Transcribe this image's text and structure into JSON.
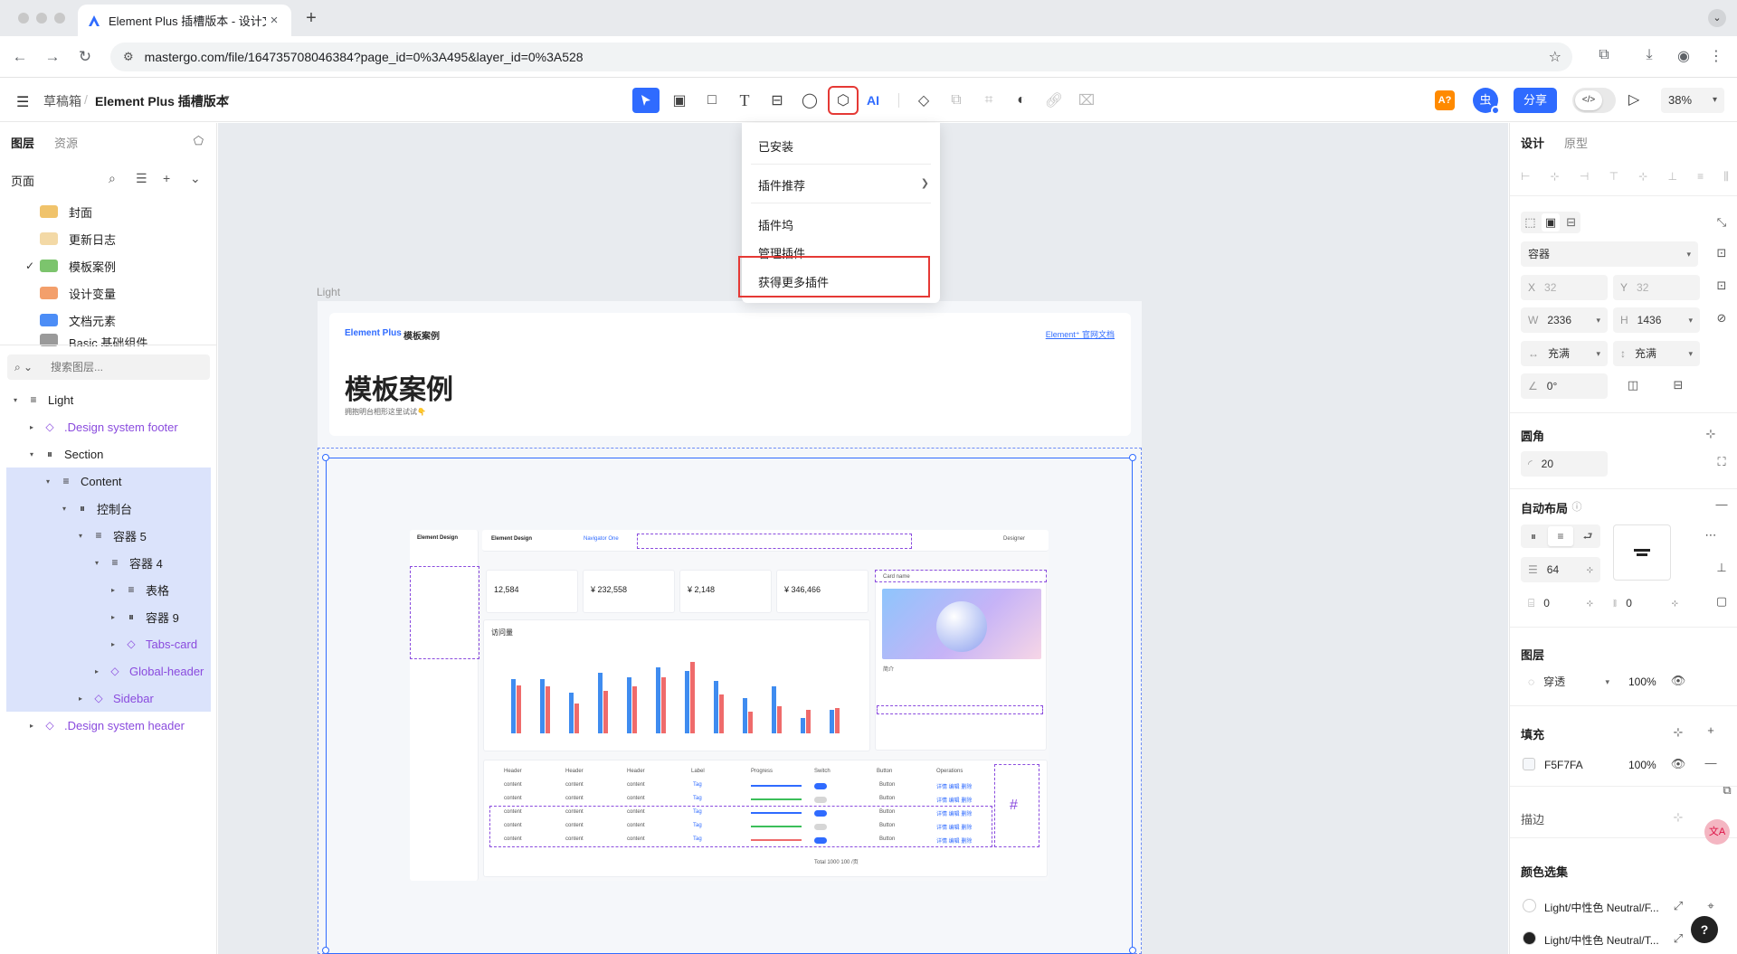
{
  "browser": {
    "tab_title": "Element Plus 插槽版本 - 设计文档",
    "url": "mastergo.com/file/164735708046384?page_id=0%3A495&layer_id=0%3A528"
  },
  "app": {
    "breadcrumb_root": "草稿箱",
    "breadcrumb_sep": "/",
    "file_name": "Element Plus 插槽版本",
    "ai_label": "AI",
    "badge_label": "A?",
    "avatar_label": "虫",
    "share_label": "分享",
    "zoom": "38%"
  },
  "left": {
    "tabs": [
      "图层",
      "资源"
    ],
    "pages_label": "页面",
    "pages": [
      {
        "name": "封面",
        "color": "#f0c36b",
        "current": false
      },
      {
        "name": "更新日志",
        "color": "#f3d9a6",
        "current": false
      },
      {
        "name": "模板案例",
        "color": "#7cc46d",
        "current": true
      },
      {
        "name": "设计变量",
        "color": "#f39f6b",
        "current": false
      },
      {
        "name": "文档元素",
        "color": "#4c8df6",
        "current": false
      },
      {
        "name": "Basic 基础组件",
        "color": "#9a9a9a",
        "current": false
      }
    ],
    "search_placeholder": "搜索图层...",
    "layers": [
      {
        "name": "Light",
        "icon": "≡",
        "indent": 0,
        "arrow": "▾",
        "selected": false,
        "component": false
      },
      {
        "name": ".Design system footer",
        "icon": "◇",
        "indent": 1,
        "arrow": "▸",
        "selected": false,
        "component": true
      },
      {
        "name": "Section",
        "icon": "⏸",
        "indent": 1,
        "arrow": "▾",
        "selected": false,
        "component": false
      },
      {
        "name": "Content",
        "icon": "≡",
        "indent": 2,
        "arrow": "▾",
        "selected": true,
        "component": false
      },
      {
        "name": "控制台",
        "icon": "⏸",
        "indent": 3,
        "arrow": "▾",
        "selected": true,
        "component": false
      },
      {
        "name": "容器 5",
        "icon": "≡",
        "indent": 4,
        "arrow": "▾",
        "selected": true,
        "component": false
      },
      {
        "name": "容器 4",
        "icon": "≡",
        "indent": 5,
        "arrow": "▾",
        "selected": true,
        "component": false
      },
      {
        "name": "表格",
        "icon": "≡",
        "indent": 6,
        "arrow": "▸",
        "selected": true,
        "component": false
      },
      {
        "name": "容器 9",
        "icon": "⏸",
        "indent": 6,
        "arrow": "▸",
        "selected": true,
        "component": false
      },
      {
        "name": "Tabs-card",
        "icon": "◇",
        "indent": 6,
        "arrow": "▸",
        "selected": true,
        "component": true
      },
      {
        "name": "Global-header",
        "icon": "◇",
        "indent": 5,
        "arrow": "▸",
        "selected": true,
        "component": true
      },
      {
        "name": "Sidebar",
        "icon": "◇",
        "indent": 4,
        "arrow": "▸",
        "selected": true,
        "component": true
      },
      {
        "name": ".Design system header",
        "icon": "◇",
        "indent": 1,
        "arrow": "▸",
        "selected": false,
        "component": true
      }
    ]
  },
  "dropdown": {
    "items": [
      "已安装",
      "插件推荐",
      "插件坞",
      "管理插件",
      "获得更多插件"
    ]
  },
  "canvas": {
    "frame_label": "Light",
    "brand": "Element Plus",
    "brand_page": "模板案例",
    "doc_link": "Element⁺ 官网文档",
    "title": "模板案例",
    "subtitle": "拥抱明台相形这里试试👇",
    "mock": {
      "logo": "Element Design",
      "logo2": "Element Design",
      "nav_item": "Navigator One",
      "user": "Designer",
      "stats": [
        "12,584",
        "¥ 232,558",
        "¥ 2,148",
        "¥ 346,466"
      ],
      "chart_title": "访问量",
      "card_name": "Card name",
      "card_sub": "简介",
      "table_headers": [
        "Header",
        "Header",
        "Header",
        "Label",
        "Progress",
        "Switch",
        "Button",
        "Operations"
      ],
      "cell": "content",
      "tag": "Tag",
      "button": "Button",
      "ops": "详情 编辑 删除",
      "pagination": "Total 1000   100 /页"
    },
    "bars": [
      [
        0.7,
        0.62
      ],
      [
        0.7,
        0.6
      ],
      [
        0.52,
        0.38
      ],
      [
        0.78,
        0.55
      ],
      [
        0.72,
        0.6
      ],
      [
        0.85,
        0.72
      ],
      [
        0.8,
        0.92
      ],
      [
        0.68,
        0.5
      ],
      [
        0.45,
        0.28
      ],
      [
        0.6,
        0.35
      ],
      [
        0.2,
        0.3
      ],
      [
        0.3,
        0.32
      ]
    ],
    "bar_colors": [
      "#3f8cf0",
      "#ef6b6b"
    ]
  },
  "right": {
    "tabs": [
      "设计",
      "原型"
    ],
    "container_type": "容器",
    "x_label": "X",
    "x": "32",
    "y_label": "Y",
    "y": "32",
    "w_label": "W",
    "w": "2336",
    "h_label": "H",
    "h": "1436",
    "resize_w": "充满",
    "resize_h": "充满",
    "rotation": "0°",
    "radius_title": "圆角",
    "radius": "20",
    "autolayout_title": "自动布局",
    "gap": "64",
    "pad_v": "0",
    "pad_h": "0",
    "layer_title": "图层",
    "blend": "穿透",
    "opacity": "100%",
    "fill_title": "填充",
    "fill_hex": "F5F7FA",
    "fill_opacity": "100%",
    "stroke_title": "描边",
    "colorsets_title": "颜色选集",
    "colorsets": [
      {
        "name": "Light/中性色 Neutral/F...",
        "color": "#ffffff"
      },
      {
        "name": "Light/中性色 Neutral/T...",
        "color": "#222222"
      }
    ],
    "help_label": "?",
    "ai_bubble": "文A"
  }
}
